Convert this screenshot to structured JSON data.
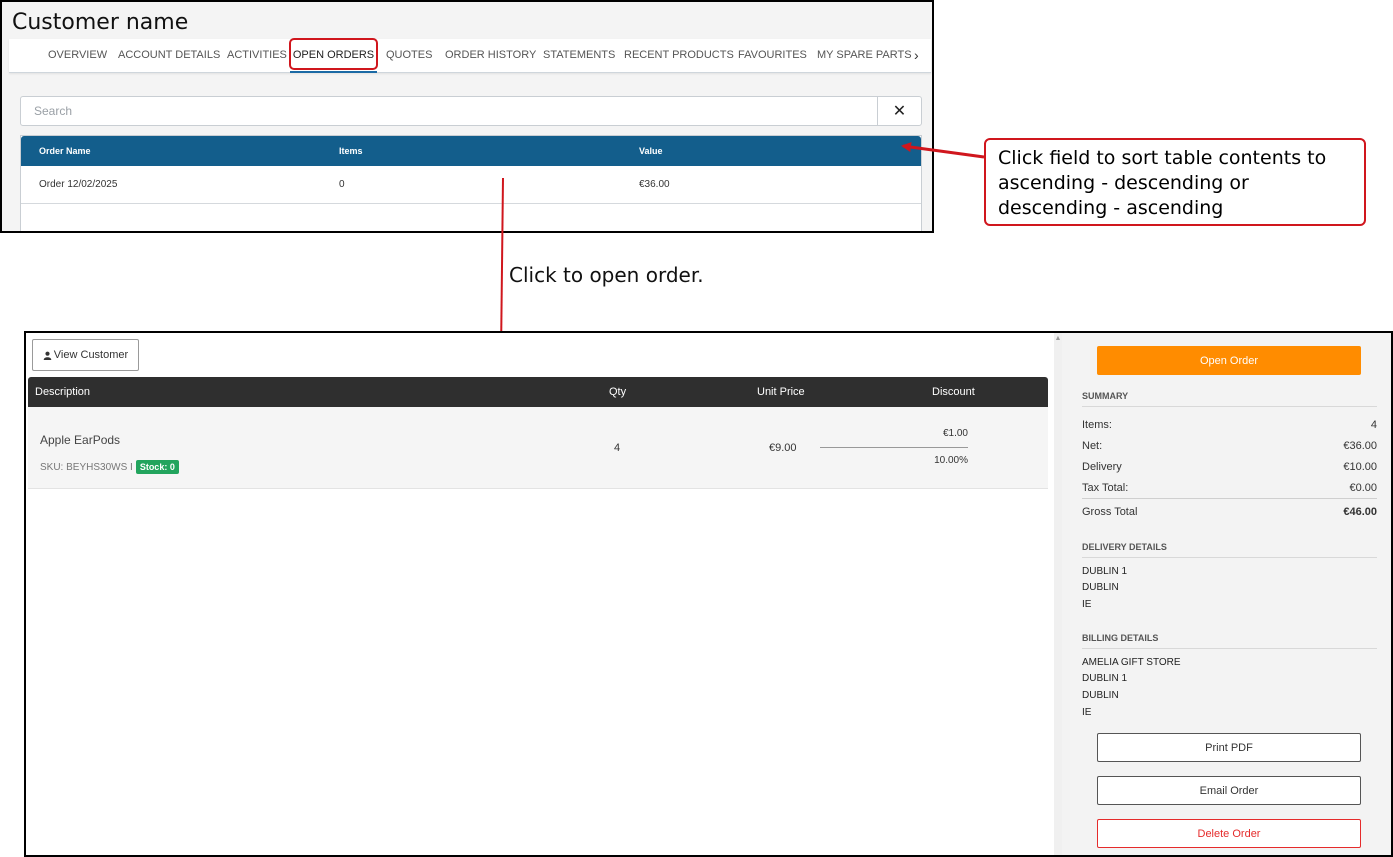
{
  "top": {
    "customer_name": "Customer name",
    "tabs": [
      {
        "label": "OVERVIEW"
      },
      {
        "label": "ACCOUNT DETAILS"
      },
      {
        "label": "ACTIVITIES"
      },
      {
        "label": "OPEN ORDERS"
      },
      {
        "label": "QUOTES"
      },
      {
        "label": "ORDER HISTORY"
      },
      {
        "label": "STATEMENTS"
      },
      {
        "label": "RECENT PRODUCTS"
      },
      {
        "label": "FAVOURITES"
      },
      {
        "label": "MY SPARE PARTS"
      }
    ],
    "active_tab": "OPEN ORDERS",
    "tabs_next_icon": "chevron-right-icon",
    "search": {
      "placeholder": "Search",
      "value": "",
      "clear_icon": "close-icon"
    },
    "orders_table": {
      "columns": [
        "Order Name",
        "Items",
        "Value"
      ],
      "rows": [
        {
          "order_name": "Order 12/02/2025",
          "items": "0",
          "value": "€36.00"
        }
      ]
    }
  },
  "annotations": {
    "sort_note": "Click field to sort table contents to ascending - descending or descending - ascending",
    "open_note": "Click to open order.",
    "color": "#d0161d"
  },
  "order": {
    "view_customer_label": "View Customer",
    "view_customer_icon": "person-icon",
    "columns": [
      "Description",
      "Qty",
      "Unit Price",
      "Discount"
    ],
    "lines": [
      {
        "description": "Apple EarPods",
        "sku": "SKU: BEYHS30WS I",
        "stock": "Stock: 0",
        "qty": "4",
        "unit_price": "€9.00",
        "discount_amount": "€1.00",
        "discount_percent": "10.00%"
      }
    ]
  },
  "sidebar": {
    "open_order_label": "Open Order",
    "summary_heading": "SUMMARY",
    "summary": {
      "items": {
        "label": "Items:",
        "value": "4"
      },
      "net": {
        "label": "Net:",
        "value": "€36.00"
      },
      "delivery": {
        "label": "Delivery",
        "value": "€10.00"
      },
      "tax": {
        "label": "Tax Total:",
        "value": "€0.00"
      },
      "gross": {
        "label": "Gross Total",
        "value": "€46.00"
      }
    },
    "delivery_heading": "DELIVERY DETAILS",
    "delivery_address": [
      "DUBLIN 1",
      "DUBLIN",
      "IE"
    ],
    "billing_heading": "BILLING DETAILS",
    "billing_address": [
      "AMELIA GIFT STORE",
      "DUBLIN 1",
      "DUBLIN",
      "IE"
    ],
    "print_pdf_label": "Print PDF",
    "email_order_label": "Email Order",
    "delete_order_label": "Delete Order"
  },
  "colors": {
    "table_header_blue": "#135e8c",
    "line_header_dark": "#2f2f2f",
    "open_order_orange": "#ff8c00",
    "stock_green": "#22a45d",
    "delete_red": "#e52b2b",
    "active_tab_underline": "#1b6aa5"
  }
}
